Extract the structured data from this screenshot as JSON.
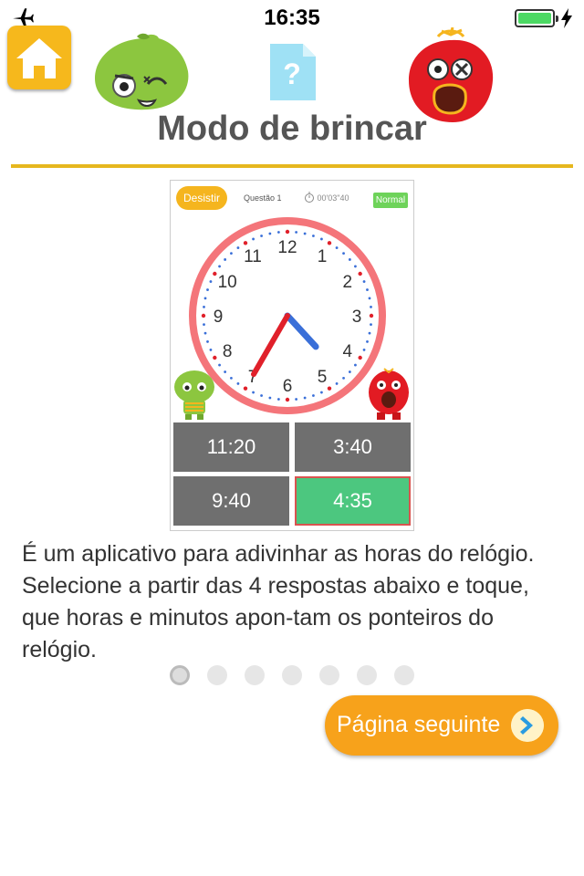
{
  "status_bar": {
    "time": "16:35"
  },
  "header": {
    "title": "Modo de brincar"
  },
  "preview": {
    "quit_label": "Desistir",
    "question_label": "Questão 1",
    "timer": "00'03\"40",
    "level_label": "Normal",
    "clock": {
      "hour": 4,
      "minute": 35,
      "numbers": [
        "12",
        "1",
        "2",
        "3",
        "4",
        "5",
        "6",
        "7",
        "8",
        "9",
        "10",
        "11"
      ]
    },
    "answers": [
      "11:20",
      "3:40",
      "9:40",
      "4:35"
    ],
    "selected_answer": "4:35"
  },
  "description": "É um aplicativo para adivinhar as horas do relógio. Selecione a partir das 4 respostas abaixo e toque, que horas e minutos apon-tam os ponteiros do relógio.",
  "pagination": {
    "pages": 7,
    "current": 1
  },
  "next_button": {
    "label": "Página seguinte"
  },
  "colors": {
    "accent": "#f7a21b",
    "rule": "#e6b71e",
    "correct": "#4cc77f",
    "answer_bg": "#6f6f6f"
  },
  "icons": [
    "airplane-icon",
    "battery-icon",
    "charging-bolt-icon",
    "home-icon",
    "document-question-icon",
    "chevron-right-icon"
  ]
}
